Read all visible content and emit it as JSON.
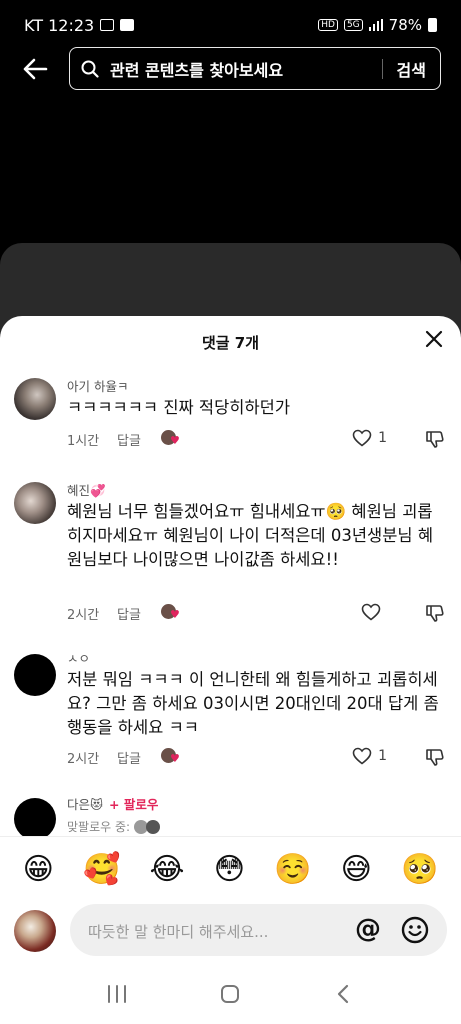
{
  "status_bar": {
    "carrier_time": "KT 12:23",
    "signal_label": "5G",
    "hd_label": "HD",
    "battery": "78%"
  },
  "search": {
    "placeholder": "관련 콘텐츠를 찾아보세요",
    "button": "검색"
  },
  "comments_sheet": {
    "title": "댓글 7개",
    "comments": [
      {
        "user": "아기 하율ㅋ",
        "text": "ㅋㅋㅋㅋㅋㅋ 진짜 적당히하던가",
        "time": "1시간",
        "reply": "답글",
        "likes": "1"
      },
      {
        "user": "혜진💞",
        "text": "혜원님 너무 힘들겠어요ㅠ 힘내세요ㅠ🥺 혜원님 괴롭히지마세요ㅠ 혜원님이 나이 더적은데 03년생분님 혜원님보다 나이많으면 나이값좀 하세요!!",
        "time": "2시간",
        "reply": "답글",
        "likes": ""
      },
      {
        "user": "ㅅㅇ",
        "text": "저분 뭐임 ㅋㅋㅋ 이 언니한테 왜 힘들게하고 괴롭히세요? 그만 좀 하세요 03이시면 20대인데 20대 답게 좀 행동을 하세요 ㅋㅋ",
        "time": "2시간",
        "reply": "답글",
        "likes": "1"
      },
      {
        "user": "다은😻",
        "follow": "+ 팔로우",
        "mutual": "맞팔로우 중:"
      }
    ]
  },
  "emoji_bar": [
    "😁",
    "🥰",
    "😂",
    "😳",
    "☺️",
    "😅",
    "🥺"
  ],
  "comment_input": {
    "placeholder": "따듯한 말 한마디 해주세요...",
    "mention": "@"
  }
}
